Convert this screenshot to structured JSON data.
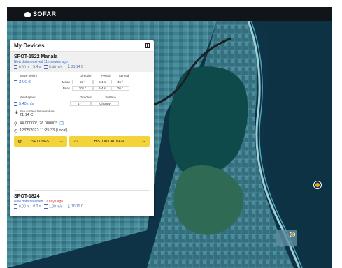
{
  "app": {
    "brand": "SOFAR"
  },
  "panel": {
    "title": "My Devices"
  },
  "device1": {
    "name": "SPOT-1522 Manala",
    "updated": "New data received 11 minutes ago",
    "quick": {
      "wave": "0.60 m",
      "period": "5.4 s",
      "wind": "5.40 m/s",
      "temp": "21.14 C"
    },
    "wave": {
      "label_height": "Wave height",
      "height": "2.00 m",
      "label_direction": "Direction",
      "label_period": "Period",
      "label_spread": "Spread",
      "row_label_mean": "Mean",
      "row_label_peak": "Peak",
      "mean_direction": "50 °",
      "mean_period": "5.4 s",
      "mean_spread": "45 °",
      "peak_direction": "101 °",
      "peak_period": "5.4 s",
      "peak_spread": "36 °"
    },
    "wind": {
      "label_speed": "Wind speed",
      "speed": "5.40 m/s",
      "label_direction": "Direction",
      "direction": "47 °",
      "label_state": "Surface",
      "state": "Choppy"
    },
    "sst_label": "Sea surface temperature",
    "sst": "21.14 C",
    "location": "44.00000°, 26.00000°",
    "timestamp": "12/05/2023 11:25:33 (Local)",
    "settings_label": "SETTINGS",
    "historical_label": "HISTORICAL DATA"
  },
  "device2": {
    "name": "SPOT-1824",
    "updated_prefix": "New data received",
    "updated_age": "12 days ago",
    "quick": {
      "wave": "0.00 m",
      "period": "0.0 s",
      "wind": "1.00 m/s",
      "temp": "10.10 C"
    }
  },
  "colors": {
    "accent": "#f4d33a",
    "link": "#2e6fd6",
    "topbar": "#111418"
  }
}
